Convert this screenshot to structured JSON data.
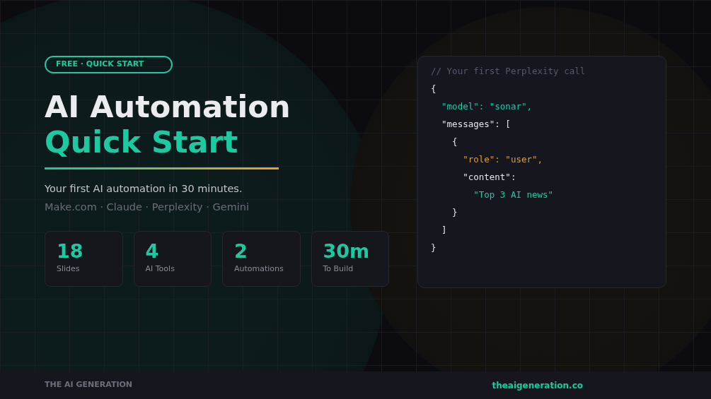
{
  "badge": "FREE · QUICK START",
  "title": {
    "line1": "AI Automation",
    "line2": "Quick Start"
  },
  "subtitle": "Your first AI automation in 30 minutes.",
  "tools": "Make.com · Claude · Perplexity · Gemini",
  "stats": [
    {
      "value": "18",
      "label": "Slides"
    },
    {
      "value": "4",
      "label": "AI Tools"
    },
    {
      "value": "2",
      "label": "Automations"
    },
    {
      "value": "30m",
      "label": "To Build"
    }
  ],
  "code": [
    {
      "kind": "comment",
      "text": "// Your first Perplexity call"
    },
    {
      "kind": "plain",
      "text": "{"
    },
    {
      "kind": "accent",
      "text": "  \"model\": \"sonar\","
    },
    {
      "kind": "plain",
      "text": "  \"messages\": ["
    },
    {
      "kind": "plain",
      "text": "    {"
    },
    {
      "kind": "warm",
      "text": "      \"role\": \"user\","
    },
    {
      "kind": "plain",
      "text": "      \"content\":"
    },
    {
      "kind": "accent",
      "text": "        \"Top 3 AI news\""
    },
    {
      "kind": "plain",
      "text": "    }"
    },
    {
      "kind": "plain",
      "text": "  ]"
    },
    {
      "kind": "plain",
      "text": "}"
    }
  ],
  "footer": {
    "brand": "THE AI GENERATION",
    "link": "theaigeneration.co"
  }
}
